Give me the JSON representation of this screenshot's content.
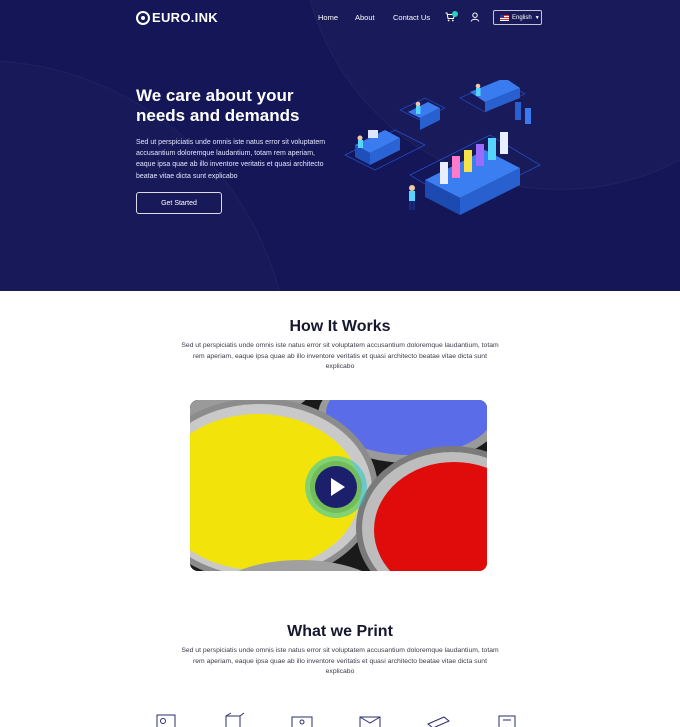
{
  "brand": {
    "name": "EURO.INK"
  },
  "nav": {
    "home": "Home",
    "about": "About",
    "contact": "Contact Us",
    "language": "English"
  },
  "hero": {
    "title": "We care about your needs and demands",
    "description": "Sed ut perspiciatis unde omnis iste natus error sit voluptatem accusantium doloremque laudantium, totam rem aperiam, eaque ipsa quae ab illo inventore veritatis et quasi architecto beatae vitae dicta sunt explicabo",
    "cta": "Get Started"
  },
  "how_it_works": {
    "title": "How It Works",
    "description": "Sed ut perspiciatis unde omnis iste natus error sit voluptatem accusantium doloremque laudantium, totam rem aperiam, eaque ipsa quae ab illo inventore veritatis et quasi architecto beatae vitae dicta sunt explicabo"
  },
  "what_we_print": {
    "title": "What we Print",
    "description": "Sed ut perspiciatis unde omnis iste natus error sit voluptatem accusantium doloremque laudantium, totam rem aperiam, eaque ipsa quae ab illo inventore veritatis et quasi architecto beatae vitae dicta sunt explicabo",
    "icons": [
      "printed-card-icon",
      "printed-box-icon",
      "printed-banner-icon",
      "printed-envelope-icon",
      "printed-paper-icon",
      "printed-folder-icon"
    ]
  },
  "colors": {
    "hero_bg": "#141657",
    "accent": "#2bd0c0",
    "play_button": "#1c1f6b"
  }
}
